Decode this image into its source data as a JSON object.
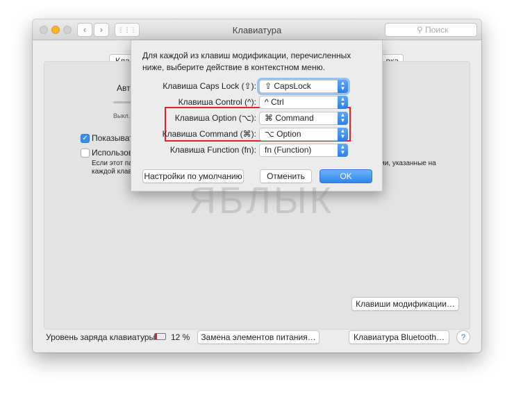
{
  "window": {
    "title": "Клавиатура",
    "search_placeholder": "Поиск"
  },
  "background": {
    "tab_left_partial": "Кла",
    "tab_right_partial": "вка",
    "auto_label_partial": "Авто",
    "slider_off_label": "Выкл.",
    "show_checkbox_label": "Показывать",
    "show_checked": true,
    "use_checkbox_label": "Использова",
    "use_checked": false,
    "hint_line1_left": "Если этот па",
    "hint_line2_left": "каждой клав",
    "hint_line1_right": "кции, указанные на",
    "modifier_keys_button": "Клавиши модификации…"
  },
  "footer": {
    "battery_label": "Уровень заряда клавиатуры:",
    "battery_percent": "12 %",
    "battery_level": 0.12,
    "replace_button": "Замена элементов питания…",
    "bluetooth_button": "Клавиатура Bluetooth…",
    "help": "?"
  },
  "sheet": {
    "intro": "Для каждой из клавиш модификации, перечисленных ниже, выберите действие в контекстном меню.",
    "rows": [
      {
        "label": "Клавиша Caps Lock (⇪):",
        "value": "⇪ CapsLock"
      },
      {
        "label": "Клавиша Control (^):",
        "value": "^ Ctrl"
      },
      {
        "label": "Клавиша Option (⌥):",
        "value": "⌘ Command"
      },
      {
        "label": "Клавиша Command (⌘):",
        "value": "⌥ Option"
      },
      {
        "label": "Клавиша Function (fn):",
        "value": "fn (Function)"
      }
    ],
    "defaults_button": "Настройки по умолчанию",
    "cancel_button": "Отменить",
    "ok_button": "OK"
  },
  "highlight_color": "#e0232b",
  "accent_color": "#2f86ec",
  "watermark": "ЯБЛЫК"
}
